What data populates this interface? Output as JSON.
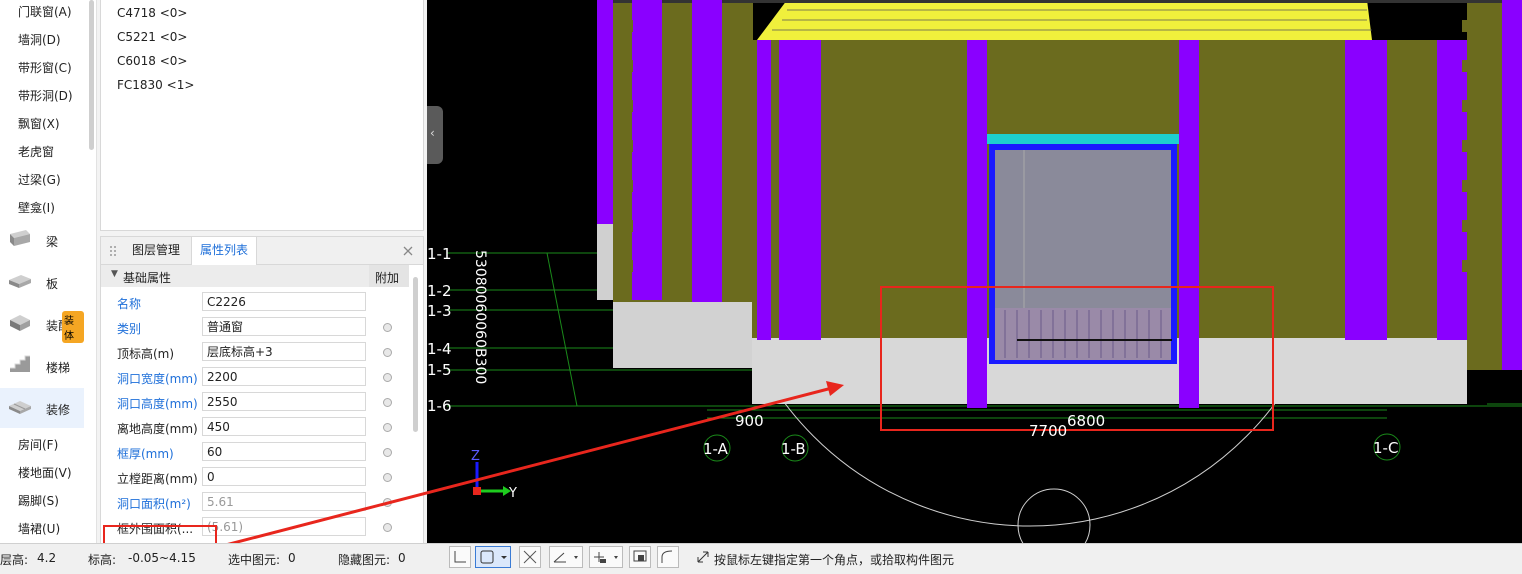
{
  "nav": {
    "top_items": [
      "门联窗(A)",
      "墙洞(D)",
      "带形窗(C)",
      "带形洞(D)",
      "飘窗(X)",
      "老虎窗",
      "过梁(G)",
      "壁龛(I)"
    ],
    "categories": [
      {
        "label": "梁",
        "icon": "beam-icon"
      },
      {
        "label": "板",
        "icon": "slab-icon"
      },
      {
        "label": "装配式",
        "icon": "prefab-icon",
        "badge": "装体"
      },
      {
        "label": "楼梯",
        "icon": "stairs-icon"
      },
      {
        "label": "装修",
        "icon": "decoration-icon"
      }
    ],
    "bottom_items": [
      "房间(F)",
      "楼地面(V)",
      "踢脚(S)",
      "墙裙(U)"
    ]
  },
  "component_list": [
    "C4718 <0>",
    "C5221 <0>",
    "C6018 <0>",
    "FC1830 <1>"
  ],
  "property_panel": {
    "tabs": [
      "图层管理",
      "属性列表"
    ],
    "active_tab": "属性列表",
    "group": "基础属性",
    "attach_header": "附加",
    "rows": [
      {
        "name": "名称",
        "value": "C2226",
        "blue": true,
        "dot": false
      },
      {
        "name": "类别",
        "value": "普通窗",
        "blue": true,
        "dot": true
      },
      {
        "name": "顶标高(m)",
        "value": "层底标高+3",
        "blue": false,
        "dot": true
      },
      {
        "name": "洞口宽度(mm)",
        "value": "2200",
        "blue": true,
        "dot": true
      },
      {
        "name": "洞口高度(mm)",
        "value": "2550",
        "blue": true,
        "dot": true
      },
      {
        "name": "离地高度(mm)",
        "value": "450",
        "blue": false,
        "dot": true
      },
      {
        "name": "框厚(mm)",
        "value": "60",
        "blue": true,
        "dot": true
      },
      {
        "name": "立樘距离(mm)",
        "value": "0",
        "blue": false,
        "dot": true
      },
      {
        "name": "洞口面积(m²)",
        "value": "5.61",
        "blue": true,
        "dot": true
      },
      {
        "name": "框外围面积(...",
        "value": "(5.61)",
        "blue": false,
        "dot": true
      }
    ]
  },
  "viewport": {
    "axis_labels_left": [
      "1-1",
      "1-2",
      "1-3",
      "1-4",
      "1-5",
      "1-6"
    ],
    "axis_labels_bottom": [
      "1-A",
      "1-B",
      "1-C"
    ],
    "vertical_dim_text": "53080060060B300",
    "dims": [
      "900",
      "7700",
      "6800"
    ],
    "axis_z": "Z",
    "axis_y": "Y"
  },
  "status": {
    "floor_height_label": "层高:",
    "floor_height": "4.2",
    "elevation_label": "标高:",
    "elevation": "-0.05~4.15",
    "selected_label": "选中图元:",
    "selected": "0",
    "hidden_label": "隐藏图元:",
    "hidden": "0",
    "hint": "按鼠标左键指定第一个角点，或拾取构件图元"
  },
  "colors": {
    "accent": "#1e6fd9",
    "annotation": "#e8261d",
    "wall": "#6b6b1e",
    "column": "#8a00ff",
    "beam": "#f0f03c",
    "frame": "#1a1aff",
    "header": "#1ecfcf"
  }
}
